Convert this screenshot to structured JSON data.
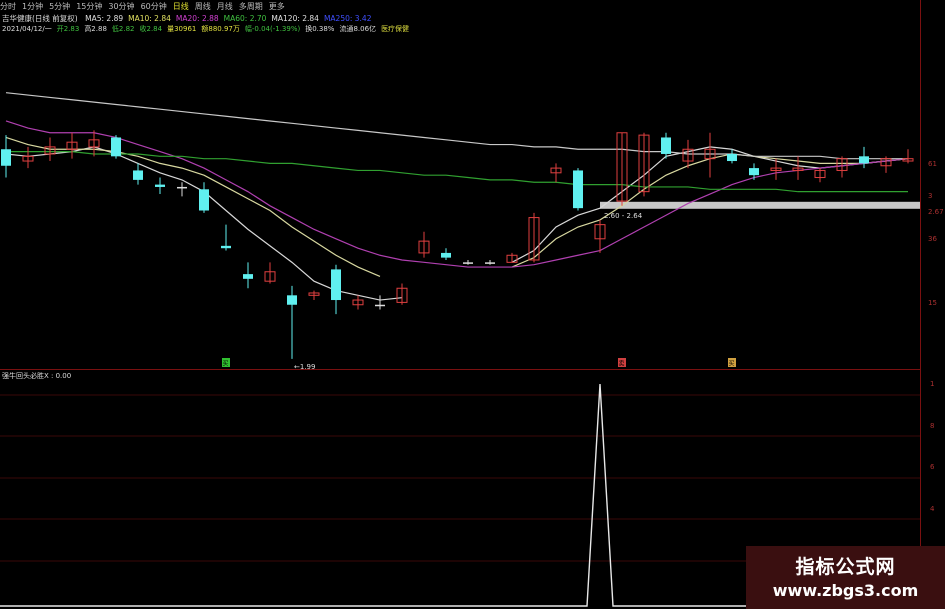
{
  "toolbar": {
    "items": [
      "分时",
      "1分钟",
      "5分钟",
      "15分钟",
      "30分钟",
      "60分钟",
      "日线",
      "周线",
      "月线",
      "多周期",
      "更多"
    ],
    "active_index": 6
  },
  "header": {
    "stock": "吉华健康(日线 前复权)",
    "ma": [
      {
        "label": "MA5: 2.89",
        "color": "#e0e0e0"
      },
      {
        "label": "MA10: 2.84",
        "color": "#e0e060"
      },
      {
        "label": "MA20: 2.88",
        "color": "#d040d0"
      },
      {
        "label": "MA60: 2.70",
        "color": "#40c040"
      },
      {
        "label": "MA120: 2.84",
        "color": "#e0e0e0"
      },
      {
        "label": "MA250: 3.42",
        "color": "#4050ff"
      }
    ],
    "quote": [
      {
        "label": "2021/04/12/一",
        "color": "#dddddd"
      },
      {
        "label": "开2.83",
        "color": "#40c040"
      },
      {
        "label": "高2.88",
        "color": "#dddddd"
      },
      {
        "label": "低2.82",
        "color": "#40c040"
      },
      {
        "label": "收2.84",
        "color": "#40c040"
      },
      {
        "label": "量30961",
        "color": "#e0e040"
      },
      {
        "label": "额880.97万",
        "color": "#e0e040"
      },
      {
        "label": "幅-0.04(-1.39%)",
        "color": "#40c040"
      },
      {
        "label": "换0.38%",
        "color": "#dddddd"
      },
      {
        "label": "流通8.06亿",
        "color": "#dddddd"
      },
      {
        "label": "医疗保健",
        "color": "#e0e040"
      }
    ]
  },
  "annotations": {
    "low_label": "←1.99",
    "range_label": "2.60 - 2.64",
    "marker_left": "买",
    "marker_mid": "卖",
    "marker_right": "买"
  },
  "price_axis": [
    "61",
    "3",
    "2.67",
    "36",
    "15"
  ],
  "indicator_axis": [
    "1",
    "8",
    "6",
    "4",
    "2"
  ],
  "indicator": {
    "label": "强牛回头必胜X : 0.00"
  },
  "watermark": {
    "line1": "指标公式网",
    "line2": "www.zbgs3.com"
  },
  "chart_data": {
    "type": "candlestick",
    "candles": [
      {
        "o": 2.88,
        "h": 2.94,
        "l": 2.76,
        "c": 2.81,
        "dir": "down"
      },
      {
        "o": 2.83,
        "h": 2.89,
        "l": 2.8,
        "c": 2.85,
        "dir": "up"
      },
      {
        "o": 2.86,
        "h": 2.93,
        "l": 2.83,
        "c": 2.89,
        "dir": "up"
      },
      {
        "o": 2.88,
        "h": 2.95,
        "l": 2.84,
        "c": 2.91,
        "dir": "up"
      },
      {
        "o": 2.89,
        "h": 2.96,
        "l": 2.85,
        "c": 2.92,
        "dir": "up"
      },
      {
        "o": 2.93,
        "h": 2.94,
        "l": 2.84,
        "c": 2.85,
        "dir": "down"
      },
      {
        "o": 2.79,
        "h": 2.82,
        "l": 2.73,
        "c": 2.75,
        "dir": "down"
      },
      {
        "o": 2.73,
        "h": 2.76,
        "l": 2.69,
        "c": 2.72,
        "dir": "down"
      },
      {
        "o": 2.72,
        "h": 2.74,
        "l": 2.68,
        "c": 2.72,
        "dir": "flat"
      },
      {
        "o": 2.71,
        "h": 2.74,
        "l": 2.61,
        "c": 2.62,
        "dir": "down"
      },
      {
        "o": 2.47,
        "h": 2.56,
        "l": 2.45,
        "c": 2.46,
        "dir": "down"
      },
      {
        "o": 2.35,
        "h": 2.4,
        "l": 2.29,
        "c": 2.33,
        "dir": "down"
      },
      {
        "o": 2.32,
        "h": 2.4,
        "l": 2.31,
        "c": 2.36,
        "dir": "up"
      },
      {
        "o": 2.26,
        "h": 2.3,
        "l": 1.99,
        "c": 2.22,
        "dir": "down"
      },
      {
        "o": 2.26,
        "h": 2.28,
        "l": 2.24,
        "c": 2.27,
        "dir": "up"
      },
      {
        "o": 2.37,
        "h": 2.39,
        "l": 2.18,
        "c": 2.24,
        "dir": "down"
      },
      {
        "o": 2.22,
        "h": 2.26,
        "l": 2.2,
        "c": 2.24,
        "dir": "up"
      },
      {
        "o": 2.22,
        "h": 2.26,
        "l": 2.2,
        "c": 2.22,
        "dir": "flat"
      },
      {
        "o": 2.23,
        "h": 2.31,
        "l": 2.22,
        "c": 2.29,
        "dir": "up"
      },
      {
        "o": 2.44,
        "h": 2.53,
        "l": 2.42,
        "c": 2.49,
        "dir": "up"
      },
      {
        "o": 2.44,
        "h": 2.46,
        "l": 2.41,
        "c": 2.42,
        "dir": "down"
      },
      {
        "o": 2.4,
        "h": 2.41,
        "l": 2.39,
        "c": 2.4,
        "dir": "flat"
      },
      {
        "o": 2.4,
        "h": 2.41,
        "l": 2.39,
        "c": 2.4,
        "dir": "flat"
      },
      {
        "o": 2.4,
        "h": 2.44,
        "l": 2.4,
        "c": 2.43,
        "dir": "up"
      },
      {
        "o": 2.41,
        "h": 2.61,
        "l": 2.4,
        "c": 2.59,
        "dir": "up"
      },
      {
        "o": 2.78,
        "h": 2.82,
        "l": 2.74,
        "c": 2.8,
        "dir": "up"
      },
      {
        "o": 2.79,
        "h": 2.8,
        "l": 2.62,
        "c": 2.63,
        "dir": "down"
      },
      {
        "o": 2.5,
        "h": 2.58,
        "l": 2.44,
        "c": 2.56,
        "dir": "up"
      },
      {
        "o": 2.66,
        "h": 2.95,
        "l": 2.64,
        "c": 2.95,
        "dir": "up"
      },
      {
        "o": 2.7,
        "h": 2.95,
        "l": 2.68,
        "c": 2.94,
        "dir": "up"
      },
      {
        "o": 2.93,
        "h": 2.95,
        "l": 2.84,
        "c": 2.86,
        "dir": "down"
      },
      {
        "o": 2.83,
        "h": 2.92,
        "l": 2.8,
        "c": 2.88,
        "dir": "up"
      },
      {
        "o": 2.84,
        "h": 2.95,
        "l": 2.76,
        "c": 2.88,
        "dir": "up"
      },
      {
        "o": 2.86,
        "h": 2.88,
        "l": 2.82,
        "c": 2.83,
        "dir": "down"
      },
      {
        "o": 2.8,
        "h": 2.82,
        "l": 2.75,
        "c": 2.77,
        "dir": "down"
      },
      {
        "o": 2.8,
        "h": 2.84,
        "l": 2.75,
        "c": 2.79,
        "dir": "up"
      },
      {
        "o": 2.79,
        "h": 2.85,
        "l": 2.75,
        "c": 2.8,
        "dir": "up"
      },
      {
        "o": 2.76,
        "h": 2.8,
        "l": 2.74,
        "c": 2.79,
        "dir": "up"
      },
      {
        "o": 2.79,
        "h": 2.85,
        "l": 2.76,
        "c": 2.84,
        "dir": "up"
      },
      {
        "o": 2.85,
        "h": 2.89,
        "l": 2.8,
        "c": 2.82,
        "dir": "down"
      },
      {
        "o": 2.81,
        "h": 2.85,
        "l": 2.78,
        "c": 2.84,
        "dir": "up"
      },
      {
        "o": 2.83,
        "h": 2.88,
        "l": 2.82,
        "c": 2.84,
        "dir": "up"
      }
    ],
    "ma_lines": [
      {
        "name": "MA5",
        "color": "#d8d8d8",
        "values": [
          2.86,
          2.85,
          2.86,
          2.87,
          2.89,
          2.86,
          2.82,
          2.78,
          2.75,
          2.7,
          2.62,
          2.54,
          2.47,
          2.4,
          2.32,
          2.28,
          2.26,
          2.24,
          2.25,
          null,
          null,
          null,
          null,
          2.4,
          2.45,
          2.55,
          2.6,
          2.63,
          2.7,
          2.77,
          2.85,
          2.87,
          2.89,
          2.88,
          2.85,
          2.83,
          2.81,
          2.8,
          2.81,
          2.82,
          2.83,
          2.84
        ]
      },
      {
        "name": "MA10",
        "color": "#d8d8a0",
        "values": [
          2.93,
          2.9,
          2.88,
          2.88,
          2.88,
          2.87,
          2.85,
          2.82,
          2.8,
          2.77,
          2.72,
          2.67,
          2.62,
          2.55,
          2.49,
          2.43,
          2.38,
          2.34,
          null,
          null,
          null,
          null,
          null,
          2.38,
          2.42,
          2.5,
          2.55,
          2.58,
          2.64,
          2.71,
          2.77,
          2.81,
          2.84,
          2.86,
          2.85,
          2.84,
          2.83,
          2.82,
          2.82,
          2.82,
          2.83,
          2.84
        ]
      },
      {
        "name": "MA20",
        "color": "#b040b0",
        "values": [
          3.0,
          2.97,
          2.95,
          2.95,
          2.95,
          2.93,
          2.9,
          2.87,
          2.84,
          2.8,
          2.75,
          2.7,
          2.64,
          2.59,
          2.54,
          2.5,
          2.46,
          2.43,
          2.41,
          2.4,
          2.39,
          2.38,
          2.38,
          2.38,
          2.39,
          2.41,
          2.43,
          2.45,
          2.5,
          2.55,
          2.6,
          2.65,
          2.69,
          2.73,
          2.76,
          2.78,
          2.79,
          2.8,
          2.81,
          2.82,
          2.83,
          2.84
        ]
      },
      {
        "name": "MA60",
        "color": "#30a030",
        "values": [
          2.87,
          2.87,
          2.87,
          2.87,
          2.86,
          2.86,
          2.86,
          2.85,
          2.85,
          2.84,
          2.84,
          2.83,
          2.82,
          2.82,
          2.81,
          2.8,
          2.79,
          2.79,
          2.78,
          2.77,
          2.77,
          2.76,
          2.75,
          2.75,
          2.74,
          2.74,
          2.73,
          2.73,
          2.73,
          2.72,
          2.72,
          2.72,
          2.71,
          2.71,
          2.71,
          2.71,
          2.7,
          2.7,
          2.7,
          2.7,
          2.7,
          2.7
        ]
      },
      {
        "name": "MA120",
        "color": "#c8c8c8",
        "values": [
          3.12,
          3.11,
          3.1,
          3.09,
          3.08,
          3.07,
          3.06,
          3.05,
          3.04,
          3.03,
          3.02,
          3.01,
          3.0,
          2.99,
          2.98,
          2.97,
          2.96,
          2.95,
          2.94,
          2.93,
          2.92,
          2.91,
          2.9,
          2.9,
          2.89,
          2.89,
          2.88,
          2.88,
          2.88,
          2.87,
          2.87,
          2.86,
          2.86,
          2.86,
          2.85,
          2.85,
          2.85,
          2.85,
          2.84,
          2.84,
          2.84,
          2.84
        ]
      }
    ],
    "support_band": [
      2.6,
      2.64
    ],
    "indicator_series": {
      "name": "强牛回头必胜X",
      "signal_index": 27,
      "peak": 1.0
    }
  }
}
